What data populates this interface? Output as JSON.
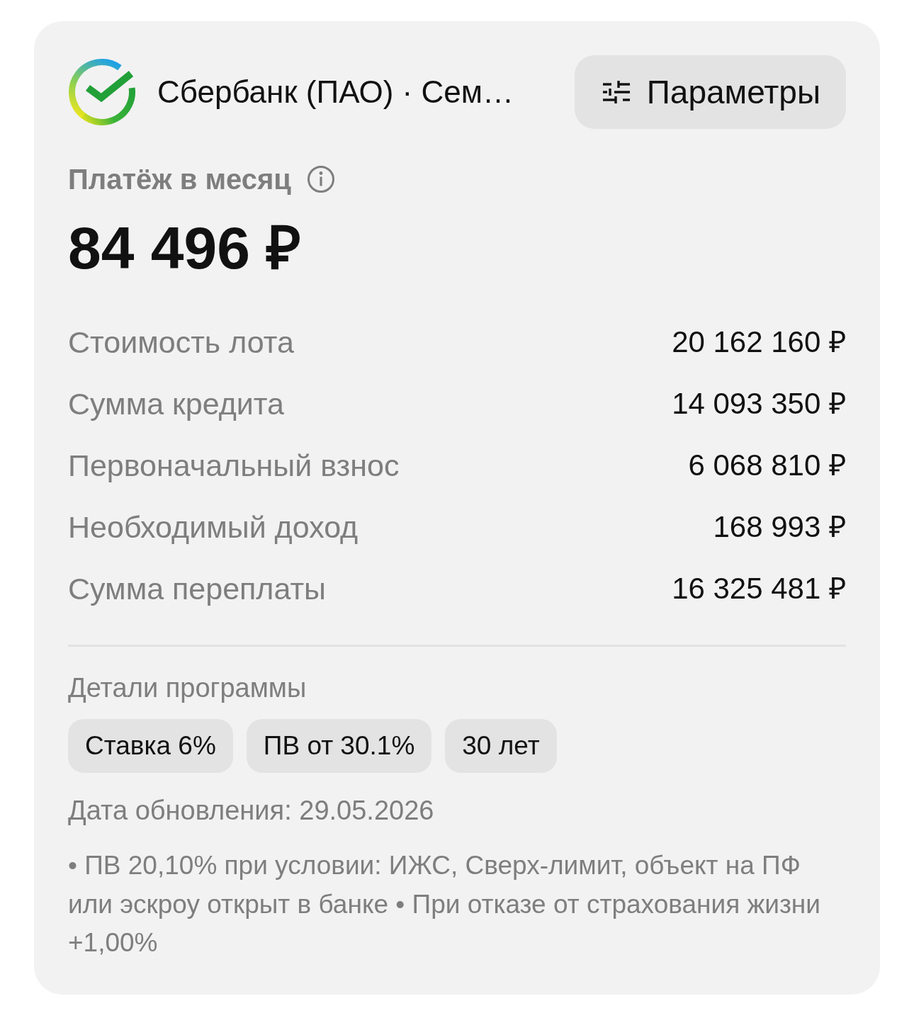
{
  "header": {
    "bank_name": "Сбербанк (ПАО) · Сем…",
    "params_button": "Параметры"
  },
  "payment": {
    "label": "Платёж в месяц",
    "amount": "84 496 ₽"
  },
  "details": [
    {
      "label": "Стоимость лота",
      "value": "20 162 160 ₽"
    },
    {
      "label": "Сумма кредита",
      "value": "14 093 350 ₽"
    },
    {
      "label": "Первоначальный взнос",
      "value": "6 068 810 ₽"
    },
    {
      "label": "Необходимый доход",
      "value": "168 993 ₽"
    },
    {
      "label": "Сумма переплаты",
      "value": "16 325 481 ₽"
    }
  ],
  "program": {
    "title": "Детали программы",
    "tags": [
      "Ставка 6%",
      "ПВ от 30.1%",
      "30 лет"
    ],
    "updated": "Дата обновления: 29.05.2026",
    "notes": "• ПВ 20,10% при условии: ИЖС, Сверх-лимит, объект на ПФ или эскроу открыт в банке • При отказе от страхования жизни +1,00%"
  }
}
